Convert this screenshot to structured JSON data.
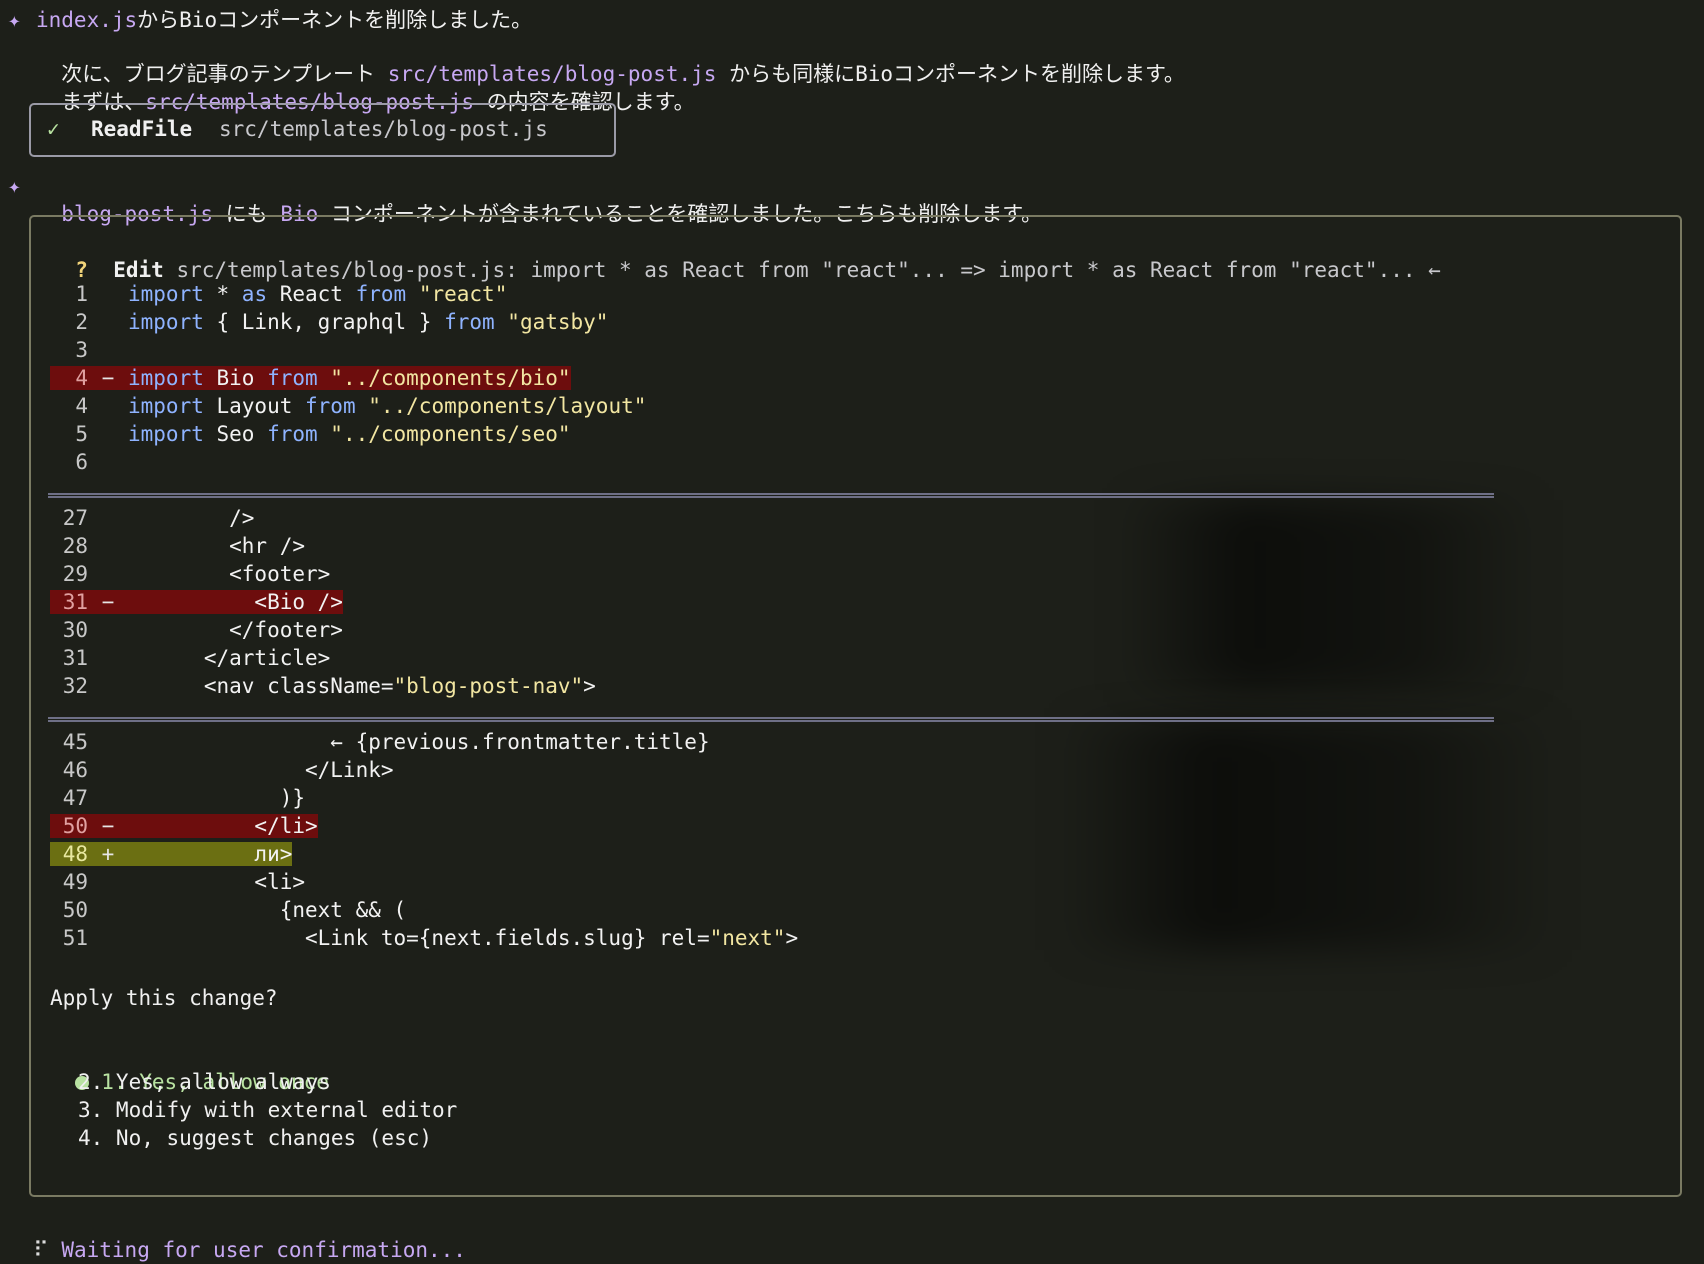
{
  "messages": {
    "m1_line1": "index.jsからBioコンポーネントを削除しました。",
    "m1_line2_pre": "次に、ブログ記事のテンプレート ",
    "m1_line2_path": "src/templates/blog-post.js",
    "m1_line2_post": " からも同様にBioコンポーネントを削除します。",
    "m1_line3_pre": "まずは、",
    "m1_line3_path": "src/templates/blog-post.js",
    "m1_line3_post": " の内容を確認します。",
    "m2_file": "blog-post.js",
    "m2_text1": " にも ",
    "m2_bio": "Bio",
    "m2_text2": " コンポーネントが含まれていることを確認しました。こちらも削除します。"
  },
  "readfile": {
    "check": "✓",
    "tool": "ReadFile",
    "path": "src/templates/blog-post.js"
  },
  "edit": {
    "question_mark": "?",
    "tool": "Edit",
    "description": "src/templates/blog-post.js: import * as React from \"react\"... => import * as React from \"react\"... ←"
  },
  "diff": {
    "hunk1": [
      {
        "num": "1",
        "sign": "",
        "kw1": "import",
        "mid": " * ",
        "kw2": "as",
        "mid2": " React ",
        "kw3": "from",
        "str": " \"react\""
      },
      {
        "num": "2",
        "sign": "",
        "kw1": "import",
        "mid": " { Link, graphql } ",
        "kw2": "from",
        "mid2": "",
        "kw3": "",
        "str": " \"gatsby\""
      },
      {
        "num": "3",
        "sign": ""
      },
      {
        "num": "4",
        "sign": "-",
        "kw1": "import",
        "mid": " Bio ",
        "kw2": "from",
        "str": " \"../components/bio\""
      },
      {
        "num": "4",
        "sign": "",
        "kw1": "import",
        "mid": " Layout ",
        "kw2": "from",
        "str": " \"../components/layout\""
      },
      {
        "num": "5",
        "sign": "",
        "kw1": "import",
        "mid": " Seo ",
        "kw2": "from",
        "str": " \"../components/seo\""
      },
      {
        "num": "6",
        "sign": ""
      }
    ],
    "hunk2": [
      {
        "num": "27",
        "sign": "",
        "code": "        />"
      },
      {
        "num": "28",
        "sign": "",
        "code": "        <hr />"
      },
      {
        "num": "29",
        "sign": "",
        "code": "        <footer>"
      },
      {
        "num": "31",
        "sign": "-",
        "code": "          <Bio />"
      },
      {
        "num": "30",
        "sign": "",
        "code": "        </footer>"
      },
      {
        "num": "31",
        "sign": "",
        "code": "      </article>"
      },
      {
        "num": "32",
        "sign": "",
        "code": "      <nav className=",
        "str": "\"blog-post-nav\"",
        "tail": ">"
      }
    ],
    "hunk3": [
      {
        "num": "45",
        "sign": "",
        "code": "                ← {previous.frontmatter.title}"
      },
      {
        "num": "46",
        "sign": "",
        "code": "              </Link>"
      },
      {
        "num": "47",
        "sign": "",
        "code": "            )}"
      },
      {
        "num": "50",
        "sign": "-",
        "code": "          </li>"
      },
      {
        "num": "48",
        "sign": "+",
        "code": "          ли>"
      },
      {
        "num": "49",
        "sign": "",
        "code": "          <li>"
      },
      {
        "num": "50",
        "sign": "",
        "code": "            {next && ("
      },
      {
        "num": "51",
        "sign": "",
        "code": "              <Link to={next.fields.slug} rel=",
        "str": "\"next\"",
        "tail": ">"
      }
    ]
  },
  "prompt": {
    "question": "Apply this change?",
    "options": [
      "1. Yes, allow once",
      "2. Yes, allow always",
      "3. Modify with external editor",
      "4. No, suggest changes (esc)"
    ]
  },
  "status": {
    "spinner": "⠏",
    "text": "Waiting for user confirmation..."
  }
}
